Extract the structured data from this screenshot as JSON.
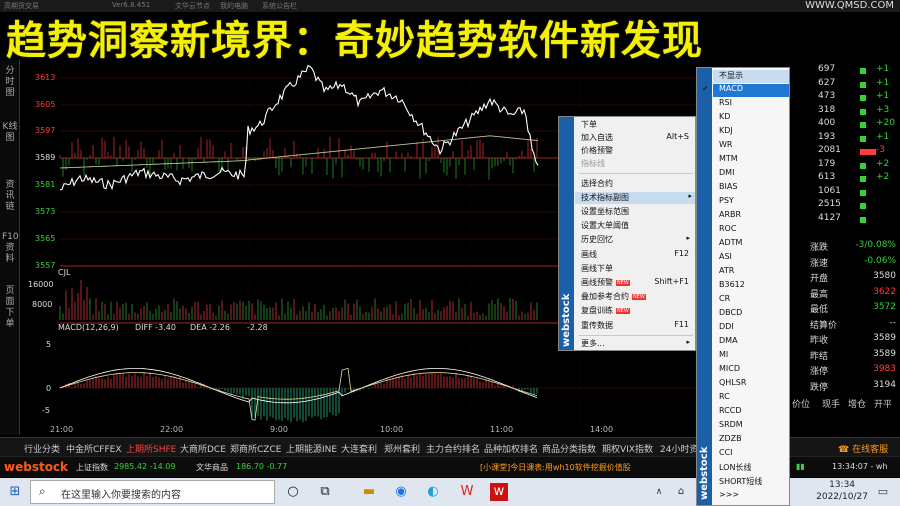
{
  "window": {
    "title_left": "高期货交易",
    "version": "Ver6.8.451",
    "link1": "文华云节点",
    "link2": "我的电脑",
    "link3": "系统公告栏"
  },
  "banner": "趋势洞察新境界：奇妙趋势软件新发现",
  "watermark": "WWW.QMSD.COM",
  "left_tabs": [
    "分时图",
    "K线图",
    "资讯链",
    "F10资料",
    "页面下单"
  ],
  "chart": {
    "price_levels": [
      {
        "label": "3613",
        "tone": "red"
      },
      {
        "label": "3605",
        "tone": "red"
      },
      {
        "label": "3597",
        "tone": "red"
      },
      {
        "label": "3589",
        "tone": "white"
      },
      {
        "label": "3581",
        "tone": "green"
      },
      {
        "label": "3573",
        "tone": "green"
      },
      {
        "label": "3565",
        "tone": "green"
      },
      {
        "label": "3557",
        "tone": "green"
      }
    ],
    "vol_label": "CJL",
    "vol_levels": [
      "16000",
      "8000"
    ],
    "macd_label": "MACD(12,26,9)",
    "diff_label": "DIFF -3.40",
    "dea_label": "DEA -2.26",
    "macd_value": "-2.28",
    "macd_levels": [
      "5",
      "0",
      "-5"
    ],
    "x_labels": [
      "21:00",
      "22:00",
      "9:00",
      "10:00",
      "11:00",
      "14:00"
    ]
  },
  "context_menu": {
    "brand": "webstock",
    "items": [
      {
        "label": "下单",
        "shortcut": ""
      },
      {
        "label": "加入自选",
        "shortcut": "Alt+S"
      },
      {
        "label": "价格预警",
        "shortcut": ""
      },
      {
        "label": "指标线",
        "shortcut": "",
        "disabled": true
      },
      {
        "label": "选择合约",
        "shortcut": ""
      },
      {
        "label": "技术指标副图",
        "shortcut": "▸",
        "highlight": true
      },
      {
        "label": "设置坐标范围",
        "shortcut": ""
      },
      {
        "label": "设置大单阈值",
        "shortcut": ""
      },
      {
        "label": "历史回忆",
        "shortcut": "▸"
      },
      {
        "label": "画线",
        "shortcut": "F12"
      },
      {
        "label": "画线下单",
        "shortcut": ""
      },
      {
        "label": "画线预警",
        "shortcut": "Shift+F1",
        "new": true
      },
      {
        "label": "叠加参考合约",
        "shortcut": "",
        "new": true
      },
      {
        "label": "复盘训练",
        "shortcut": "",
        "new": true
      },
      {
        "label": "重传数据",
        "shortcut": "F11"
      },
      {
        "label": "更多...",
        "shortcut": "▸"
      }
    ],
    "new_badge": "NEW"
  },
  "indicator_submenu": {
    "brand": "webstock",
    "items": [
      "不显示",
      "MACD",
      "RSI",
      "KD",
      "KDJ",
      "WR",
      "MTM",
      "DMI",
      "BIAS",
      "PSY",
      "ARBR",
      "ROC",
      "ADTM",
      "ASI",
      "ATR",
      "B3612",
      "CR",
      "DBCD",
      "DDI",
      "DMA",
      "MI",
      "MICD",
      "QHLSR",
      "RC",
      "RCCD",
      "SRDM",
      "ZDZB",
      "CCI",
      "LON长线",
      "SHORT短线",
      ">>>"
    ],
    "checked": "MACD"
  },
  "right_panel": {
    "rows": [
      {
        "a": "697",
        "b": "+1"
      },
      {
        "a": "627",
        "b": "+1"
      },
      {
        "a": "473",
        "b": "+1"
      },
      {
        "a": "318",
        "b": "+3"
      },
      {
        "a": "400",
        "b": "+20"
      },
      {
        "a": "193",
        "b": "+1"
      },
      {
        "a": "2081",
        "b": "-3"
      },
      {
        "a": "179",
        "b": "+2"
      },
      {
        "a": "613",
        "b": "+2"
      },
      {
        "a": "1061",
        "b": ""
      },
      {
        "a": "2515",
        "b": ""
      },
      {
        "a": "4127",
        "b": ""
      }
    ],
    "stats": [
      {
        "k": "涨跌",
        "v": "-3/0.08%"
      },
      {
        "k": "涨速",
        "v": "-0.06%"
      },
      {
        "k": "开盘",
        "v": "3580"
      },
      {
        "k": "最高",
        "v": "3622"
      },
      {
        "k": "最低",
        "v": "3572"
      },
      {
        "k": "结算价",
        "v": "--"
      },
      {
        "k": "昨收",
        "v": "3589"
      },
      {
        "k": "昨结",
        "v": "3589"
      },
      {
        "k": "涨停",
        "v": "3983"
      },
      {
        "k": "跌停",
        "v": "3194"
      }
    ],
    "footer": [
      "价位",
      "现手",
      "增仓",
      "开平"
    ]
  },
  "tabs": [
    "行业分类",
    "中金所CFFEX",
    "上期所SHFE",
    "大商所DCE",
    "郑商所CZCE",
    "上期能源INE",
    "大连套利",
    "郑州套利",
    "主力合约排名",
    "品种加权排名",
    "商品分类指数",
    "期权VIX指数",
    "24小时资讯"
  ],
  "tab_active": "上期所SHFE",
  "online_service": "在线客服",
  "status": {
    "logo": "webstock",
    "index_label": "上证指数",
    "index_values": "2985.42 -14.09",
    "wenhua_label": "文华商品",
    "wenhua_values": "186.70 -0.77",
    "ticker": "[小课堂]今日课表:用wh10软件挖掘价值股",
    "time": "13:34:07 - wh"
  },
  "taskbar": {
    "search_placeholder": "在这里输入你要搜索的内容",
    "time": "13:34",
    "date": "2022/10/27"
  }
}
